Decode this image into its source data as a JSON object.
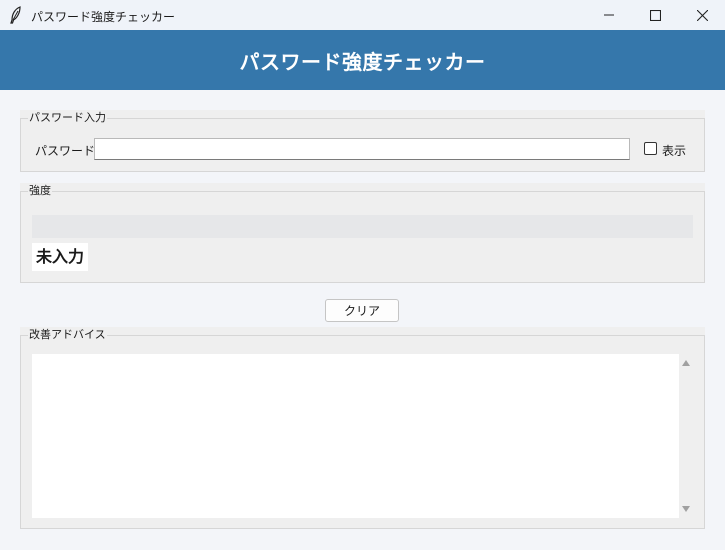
{
  "window": {
    "title": "パスワード強度チェッカー",
    "icon": "feather-icon"
  },
  "header": {
    "title": "パスワード強度チェッカー",
    "background": "#3577ab"
  },
  "password_group": {
    "label": "パスワード入力",
    "field_label": "パスワード:",
    "value": "",
    "show_label": "表示",
    "show_checked": false
  },
  "strength_group": {
    "label": "強度",
    "progress": 0,
    "status": "未入力"
  },
  "clear_button": {
    "label": "クリア"
  },
  "advice_group": {
    "label": "改善アドバイス",
    "text": ""
  }
}
